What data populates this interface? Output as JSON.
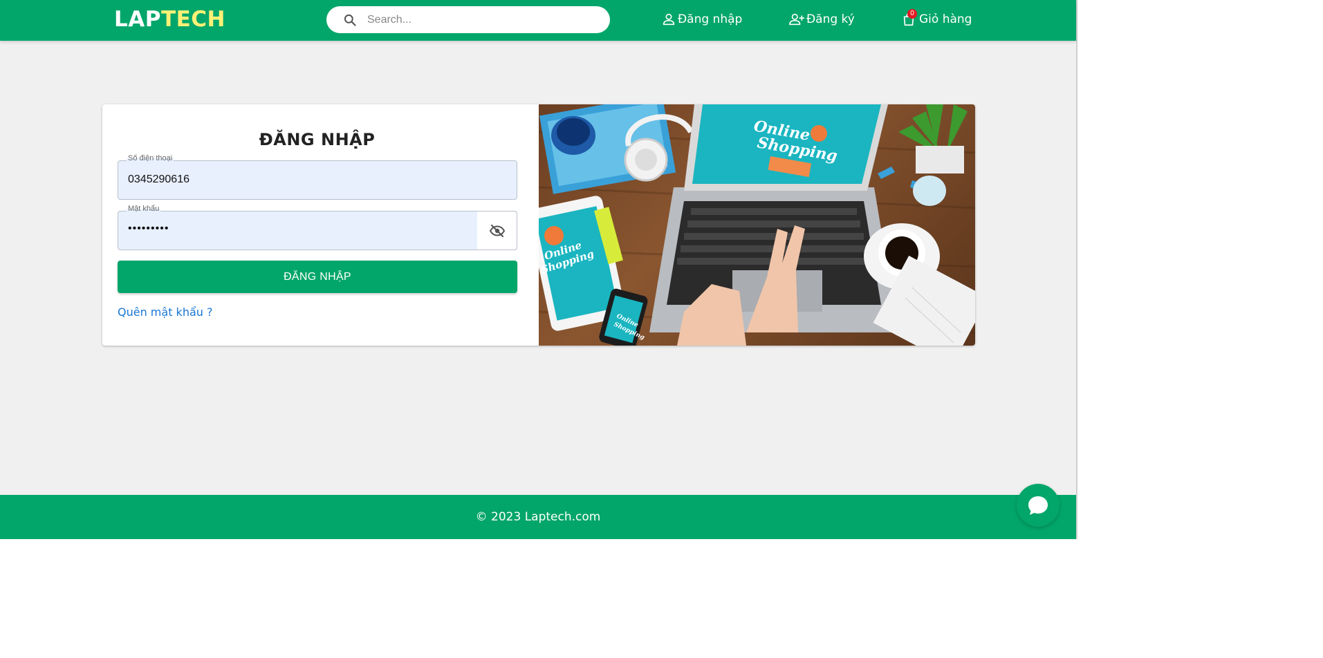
{
  "header": {
    "logo_primary": "LAP",
    "logo_accent": "TECH",
    "search_placeholder": "Search...",
    "nav": {
      "login": "Đăng nhập",
      "register": "Đăng ký",
      "cart": "Giỏ hàng",
      "cart_count": "0"
    }
  },
  "login_form": {
    "title": "ĐĂNG NHẬP",
    "phone_label": "Số điện thoại",
    "phone_value": "0345290616",
    "password_label": "Mật khẩu",
    "password_value": "•••••••••",
    "submit_label": "ĐĂNG NHẬP",
    "forgot_label": "Quên mật khẩu ?"
  },
  "illustration": {
    "laptop_screen_text_1": "Online",
    "laptop_screen_text_2": "Shopping",
    "tablet_text_1": "Online",
    "tablet_text_2": "Shopping",
    "phone_text_1": "Online",
    "phone_text_2": "Shopping"
  },
  "footer": {
    "copyright": "© 2023 Laptech.com"
  },
  "colors": {
    "brand_green": "#03a66a",
    "logo_accent": "#fff176",
    "link_blue": "#1976d2",
    "badge_red": "#e31b23",
    "input_bg": "#e8f0fe"
  },
  "icons": {
    "search": "search-icon",
    "user": "user-icon",
    "user_add": "user-add-icon",
    "cart": "shopping-bag-icon",
    "visibility_off": "eye-off-icon",
    "chat": "chat-icon"
  }
}
